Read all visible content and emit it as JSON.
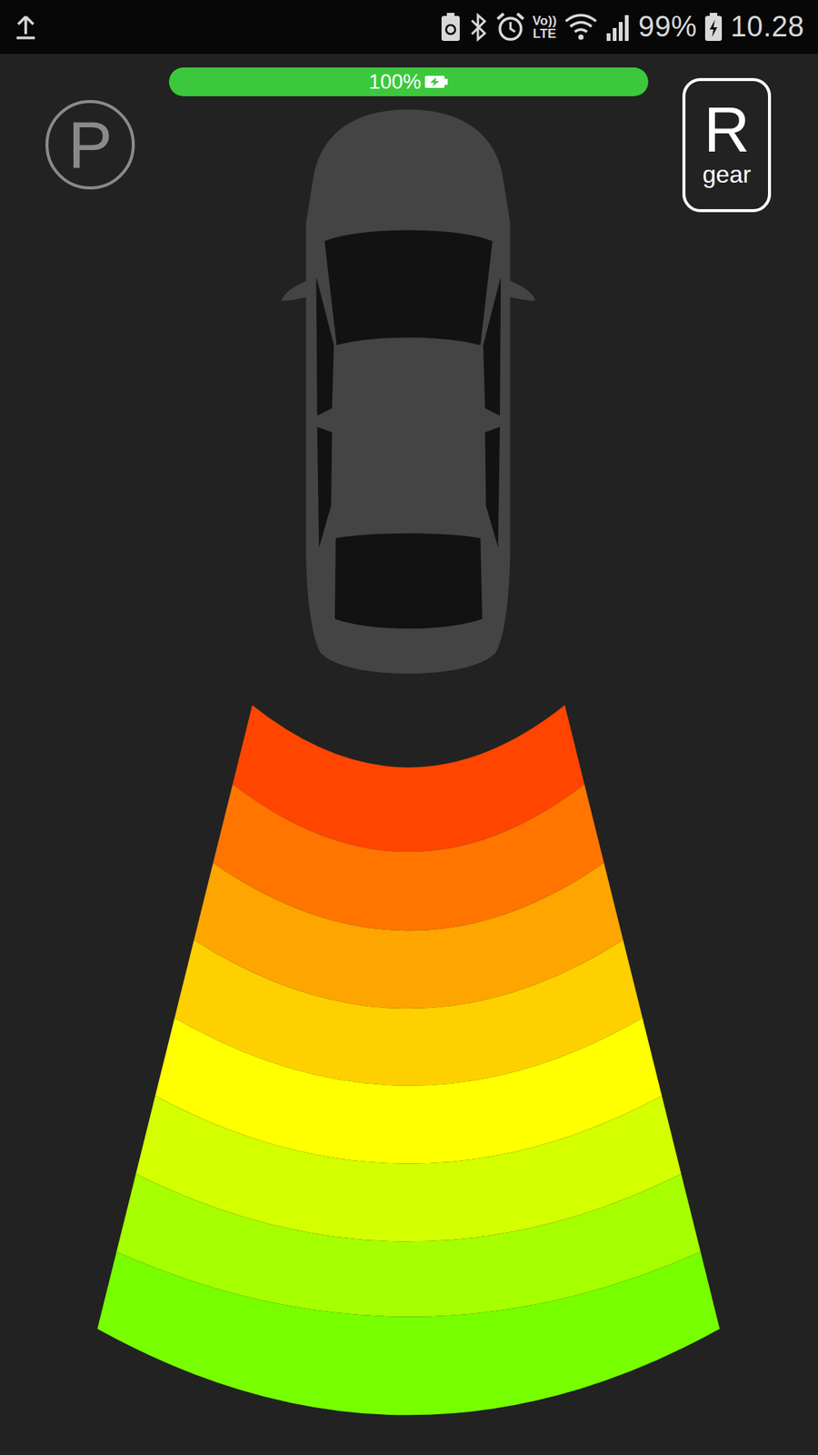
{
  "status_bar": {
    "time": "10.28",
    "battery": "99%",
    "network": [
      "Vo))",
      "LTE"
    ]
  },
  "battery": {
    "label": "100%",
    "level": 1.0,
    "charging": true
  },
  "parking": {
    "label": "P"
  },
  "gear": {
    "label": "R",
    "caption": "gear"
  },
  "sensor": {
    "zones": [
      {
        "color": "#ff4500",
        "active": true
      },
      {
        "color": "#ff7500",
        "active": true
      },
      {
        "color": "#ffa500",
        "active": true
      },
      {
        "color": "#ffd000",
        "active": true
      },
      {
        "color": "#ffff00",
        "active": true
      },
      {
        "color": "#d4ff00",
        "active": true
      },
      {
        "color": "#a6ff00",
        "active": true
      },
      {
        "color": "#77ff00",
        "active": true
      }
    ]
  }
}
